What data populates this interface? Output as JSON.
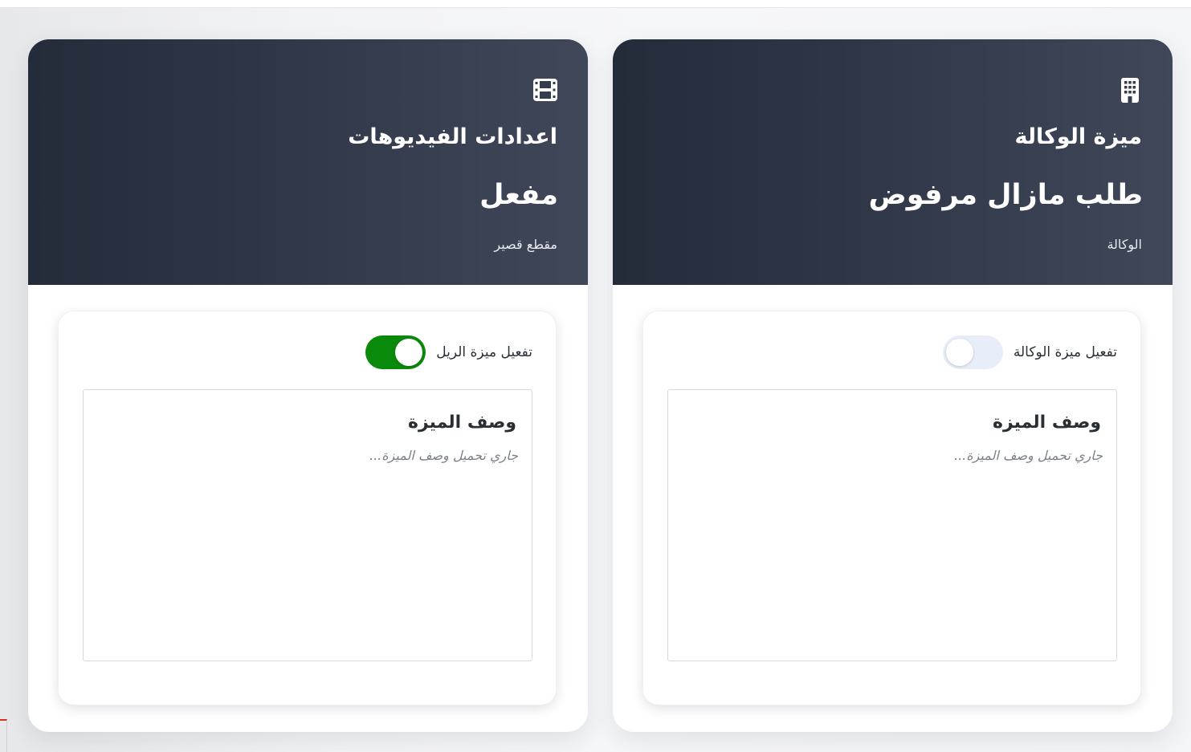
{
  "cards": [
    {
      "icon": "film-icon",
      "title": "اعدادات الفيديوهات",
      "status": "مفعل",
      "subtitle": "مقطع قصير",
      "toggle_label": "تفعيل ميزة الريل",
      "toggle_on": true,
      "description_title": "وصف الميزة",
      "description_text": "جاري تحميل وصف الميزة..."
    },
    {
      "icon": "building-icon",
      "title": "ميزة الوكالة",
      "status": "طلب مازال مرفوض",
      "subtitle": "الوكالة",
      "toggle_label": "تفعيل ميزة الوكالة",
      "toggle_on": false,
      "description_title": "وصف الميزة",
      "description_text": "جاري تحميل وصف الميزة..."
    }
  ],
  "colors": {
    "header_gradient_start": "#242b39",
    "header_gradient_end": "#3f4759",
    "toggle_on": "#0a8a0a",
    "toggle_off": "#e8eef9"
  }
}
